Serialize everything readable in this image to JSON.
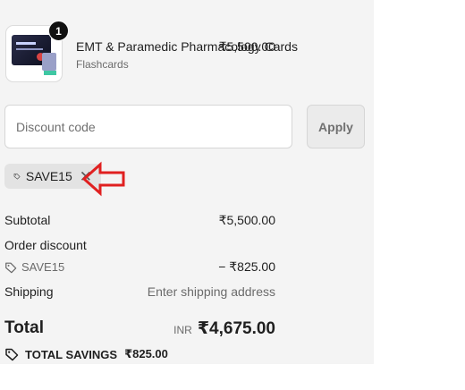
{
  "product": {
    "quantity": "1",
    "name": "EMT & Paramedic Pharmacology Cards",
    "variant": "Flashcards",
    "price": "₹5,500.00"
  },
  "discount": {
    "placeholder": "Discount code",
    "apply_label": "Apply",
    "applied_code": "SAVE15"
  },
  "summary": {
    "subtotal_label": "Subtotal",
    "subtotal_value": "₹5,500.00",
    "order_discount_label": "Order discount",
    "discount_code": "SAVE15",
    "discount_value": "− ₹825.00",
    "shipping_label": "Shipping",
    "shipping_value": "Enter shipping address",
    "total_label": "Total",
    "currency": "INR",
    "total_value": "₹4,675.00",
    "savings_label": "TOTAL SAVINGS",
    "savings_value": "₹825.00"
  },
  "colors": {
    "annotation_arrow": "#e02020",
    "panel": "#f4f4f4"
  },
  "icons": [
    "tag-icon",
    "close-icon",
    "product-thumbnail"
  ]
}
